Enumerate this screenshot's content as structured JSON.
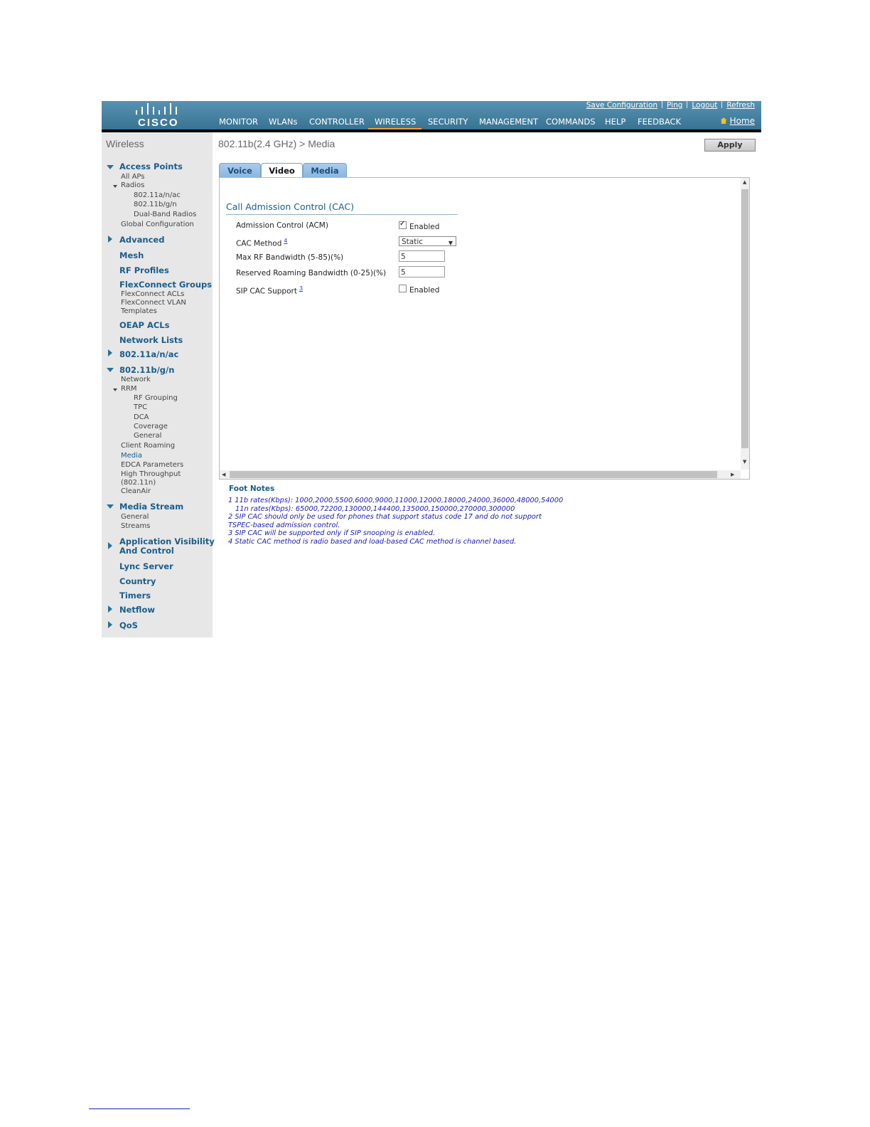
{
  "header": {
    "logo_text": "CISCO",
    "top_links": [
      "Save Configuration",
      "Ping",
      "Logout",
      "Refresh"
    ],
    "nav": [
      "MONITOR",
      "WLANs",
      "CONTROLLER",
      "WIRELESS",
      "SECURITY",
      "MANAGEMENT",
      "COMMANDS",
      "HELP",
      "FEEDBACK"
    ],
    "active_nav": "WIRELESS",
    "home": "Home",
    "active_color": "#f0a030"
  },
  "sidebar": {
    "title": "Wireless",
    "access_points": "Access Points",
    "all_aps": "All APs",
    "radios": "Radios",
    "radio_a": "802.11a/n/ac",
    "radio_b": "802.11b/g/n",
    "dual_band": "Dual-Band Radios",
    "global_config": "Global Configuration",
    "advanced": "Advanced",
    "mesh": "Mesh",
    "rf_profiles": "RF Profiles",
    "flex_groups": "FlexConnect Groups",
    "flex_acls": "FlexConnect ACLs",
    "flex_vlan_1": "FlexConnect VLAN",
    "flex_vlan_2": "Templates",
    "oeap": "OEAP ACLs",
    "network_lists": "Network Lists",
    "a_band": "802.11a/n/ac",
    "b_band": "802.11b/g/n",
    "network": "Network",
    "rrm": "RRM",
    "rf_grouping": "RF Grouping",
    "tpc": "TPC",
    "dca": "DCA",
    "coverage": "Coverage",
    "general": "General",
    "client_roaming": "Client Roaming",
    "media": "Media",
    "edca": "EDCA Parameters",
    "ht_1": "High Throughput",
    "ht_2": "(802.11n)",
    "cleanair": "CleanAir",
    "media_stream": "Media Stream",
    "ms_general": "General",
    "ms_streams": "Streams",
    "avc_1": "Application Visibility",
    "avc_2": "And Control",
    "lync": "Lync Server",
    "country": "Country",
    "timers": "Timers",
    "netflow": "Netflow",
    "qos": "QoS"
  },
  "main": {
    "title": "802.11b(2.4 GHz) > Media",
    "apply": "Apply",
    "tabs": [
      "Voice",
      "Video",
      "Media"
    ],
    "active_tab": "Video",
    "section": "Call Admission Control (CAC)",
    "fields": {
      "acm_label": "Admission Control (ACM)",
      "acm_value": "Enabled",
      "cac_method_label": "CAC Method",
      "cac_method_sup": "4",
      "cac_method_value": "Static",
      "max_rf_label": "Max RF Bandwidth (5-85)(%)",
      "max_rf_value": "5",
      "roaming_label": "Reserved Roaming Bandwidth (0-25)(%)",
      "roaming_value": "5",
      "sip_label": "SIP CAC Support",
      "sip_sup": "3",
      "sip_value": "Enabled"
    }
  },
  "footnotes": {
    "title": "Foot Notes",
    "lines": [
      "1 11b rates(Kbps): 1000,2000,5500,6000,9000,11000,12000,18000,24000,36000,48000,54000",
      "   11n rates(Kbps): 65000,72200,130000,144400,135000,150000,270000,300000",
      "2 SIP CAC should only be used for phones that support status code 17 and do not support",
      "TSPEC-based admission control.",
      "3 SIP CAC will be supported only if SIP snooping is enabled.",
      "4 Static CAC method is radio based and load-based CAC method is channel based."
    ]
  }
}
